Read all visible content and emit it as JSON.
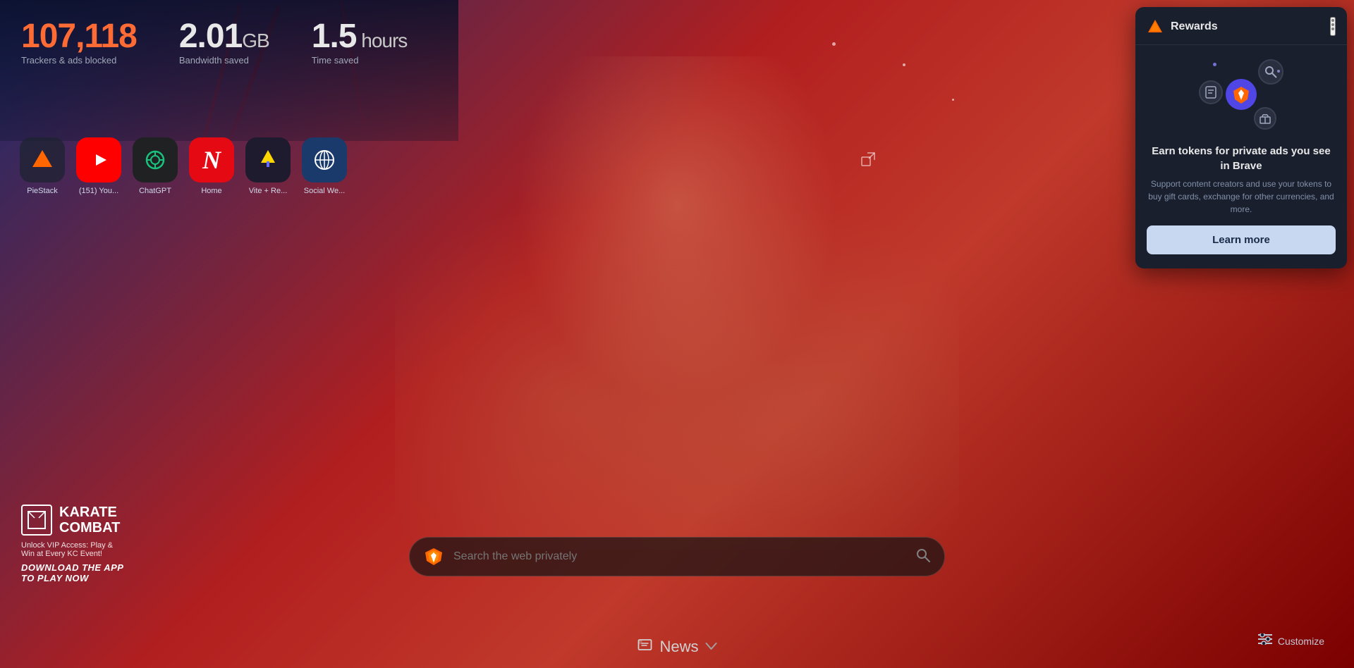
{
  "stats": {
    "trackers_count": "107,118",
    "trackers_label": "Trackers & ads blocked",
    "bandwidth_value": "2.01",
    "bandwidth_unit": "GB",
    "bandwidth_label": "Bandwidth saved",
    "time_value": "1.5",
    "time_unit": "hours",
    "time_label": "Time saved"
  },
  "shortcuts": [
    {
      "id": "piestack",
      "label": "PieStack",
      "icon": "▲",
      "color": "dark-bg"
    },
    {
      "id": "youtube",
      "label": "(151) You...",
      "icon": "▶",
      "color": "red-bg"
    },
    {
      "id": "chatgpt",
      "label": "ChatGPT",
      "icon": "◎",
      "color": "dark-gray"
    },
    {
      "id": "home",
      "label": "Home",
      "icon": "N",
      "color": "red-bright"
    },
    {
      "id": "vite",
      "label": "Vite + Re...",
      "icon": "⚡",
      "color": "dark-purple"
    },
    {
      "id": "social",
      "label": "Social We...",
      "icon": "🌐",
      "color": "blue-globe"
    }
  ],
  "search": {
    "placeholder": "Search the web privately"
  },
  "news": {
    "label": "News",
    "chevron": "∨"
  },
  "customize": {
    "label": "Customize"
  },
  "rewards": {
    "title": "Rewards",
    "earn_title": "Earn tokens for private ads you see in Brave",
    "description": "Support content creators and use your tokens to buy gift cards, exchange for other currencies, and more.",
    "learn_more_label": "Learn more"
  },
  "karate": {
    "logo_text": "KARATE\nCOMBAT",
    "subtitle": "Unlock VIP Access: Play &\nWin at Every KC Event!",
    "cta": "DOWNLOAD THE APP\nTO PLAY NOW"
  },
  "icons": {
    "search": "🔍",
    "news": "📰",
    "customize": "≡",
    "external_link": "⊡",
    "menu": "⋮",
    "brave_rewards_triangle": "△"
  }
}
